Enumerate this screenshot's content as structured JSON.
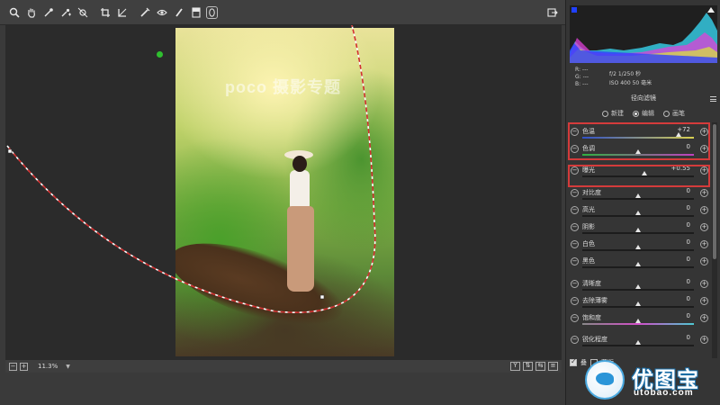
{
  "toolbar": {
    "tools": [
      "zoom-icon",
      "hand-icon",
      "eyedropper-icon",
      "color-sampler-icon",
      "target-adjust-icon",
      "crop-icon",
      "heal-icon",
      "redeye-icon",
      "brush-icon",
      "graduated-filter-icon",
      "radial-filter-icon"
    ]
  },
  "canvas": {
    "watermark": "poco 摄影专题"
  },
  "status": {
    "zoom": "11.3%",
    "y_button": "Y"
  },
  "histogram": {
    "rgb_r": "R: ---",
    "rgb_g": "G: ---",
    "rgb_b": "B: ---",
    "exif_line1": "f/2  1/250 秒",
    "exif_line2": "ISO 400  50 毫米"
  },
  "panel": {
    "title": "径向滤镜",
    "modes": [
      {
        "label": "新建",
        "selected": false
      },
      {
        "label": "编辑",
        "selected": true
      },
      {
        "label": "画笔",
        "selected": false
      }
    ],
    "sliders": [
      {
        "label": "色温",
        "value": "+72",
        "pos": 0.86
      },
      {
        "label": "色调",
        "value": "0",
        "pos": 0.5
      },
      {
        "label": "曝光",
        "value": "+0.55",
        "pos": 0.56
      },
      {
        "label": "对比度",
        "value": "0",
        "pos": 0.5
      },
      {
        "label": "高光",
        "value": "0",
        "pos": 0.5
      },
      {
        "label": "阴影",
        "value": "0",
        "pos": 0.5
      },
      {
        "label": "白色",
        "value": "0",
        "pos": 0.5
      },
      {
        "label": "黑色",
        "value": "0",
        "pos": 0.5
      },
      {
        "label": "清晰度",
        "value": "0",
        "pos": 0.5
      },
      {
        "label": "去除薄雾",
        "value": "0",
        "pos": 0.5
      },
      {
        "label": "饱和度",
        "value": "0",
        "pos": 0.5
      },
      {
        "label": "锐化程度",
        "value": "0",
        "pos": 0.5
      }
    ],
    "bottom_check1": "叠",
    "bottom_check2": "蒙版"
  },
  "brand": {
    "name": "优图宝",
    "url": "utobao.com"
  },
  "colors": {
    "highlight_box": "#d43b3b",
    "mask_pin": "#2fbf2f"
  }
}
